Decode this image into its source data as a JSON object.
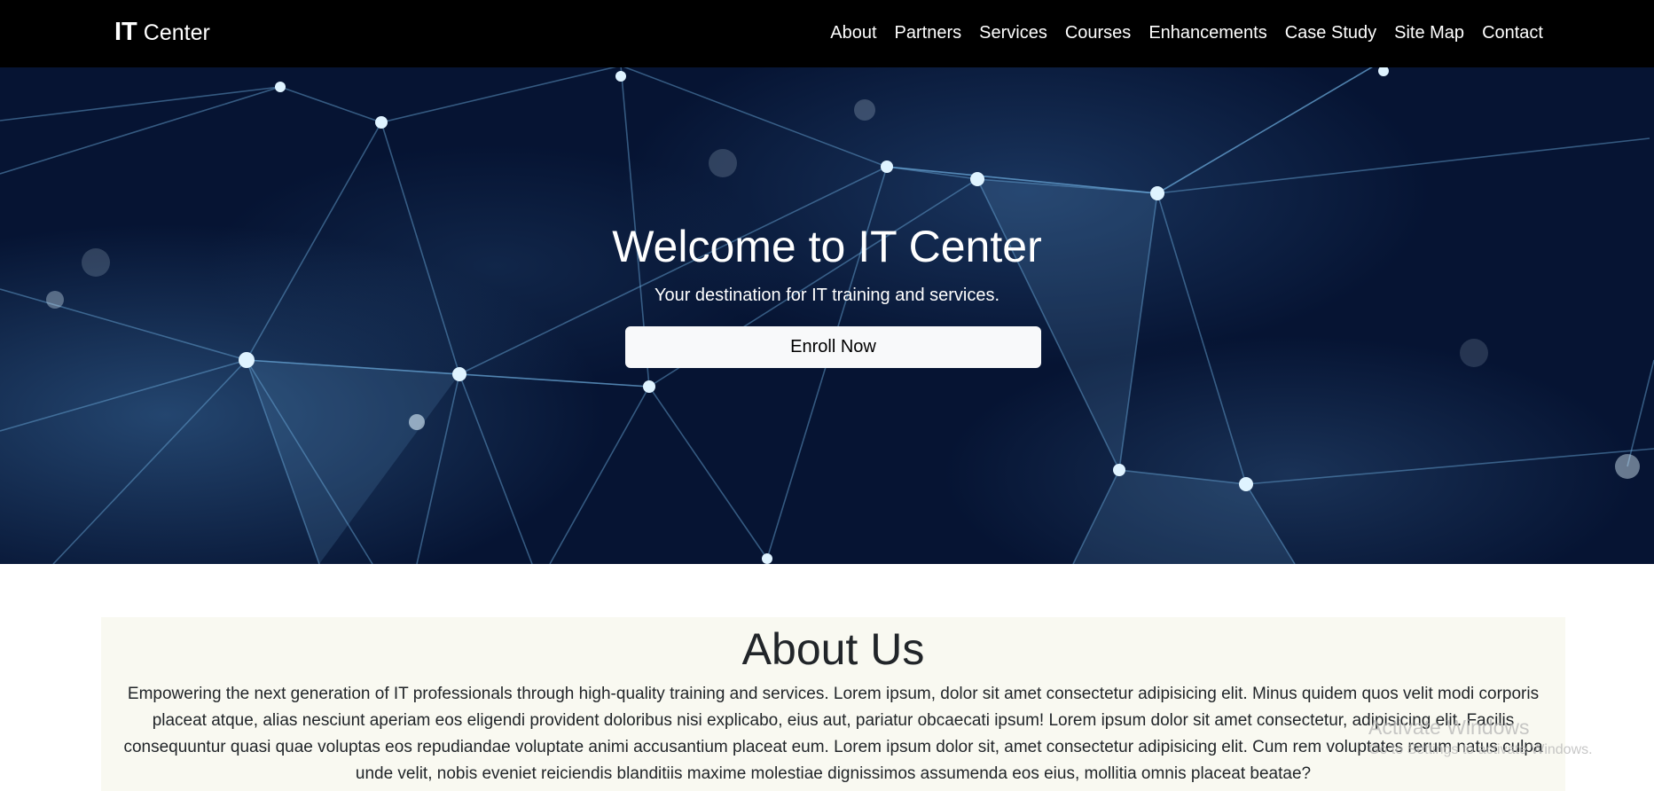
{
  "navbar": {
    "brand_strong": "IT",
    "brand_light": "Center",
    "links": [
      "About",
      "Partners",
      "Services",
      "Courses",
      "Enhancements",
      "Case Study",
      "Site Map",
      "Contact"
    ]
  },
  "hero": {
    "title": "Welcome to IT Center",
    "subtitle": "Your destination for IT training and services.",
    "button_label": "Enroll Now"
  },
  "about": {
    "title": "About Us",
    "text": "Empowering the next generation of IT professionals through high-quality training and services. Lorem ipsum, dolor sit amet consectetur adipisicing elit. Minus quidem quos velit modi corporis placeat atque, alias nesciunt aperiam eos eligendi provident doloribus nisi explicabo, eius aut, pariatur obcaecati ipsum! Lorem ipsum dolor sit amet consectetur, adipisicing elit. Facilis consequuntur quasi quae voluptas eos repudiandae voluptate animi accusantium placeat eum. Lorem ipsum dolor sit, amet consectetur adipisicing elit. Cum rem voluptates rerum natus culpa unde velit, nobis eveniet reiciendis blanditiis maxime molestiae dignissimos assumenda eos eius, mollitia omnis placeat beatae?"
  },
  "watermark": {
    "title": "Activate Windows",
    "subtitle": "Go to Settings to activate Windows."
  },
  "colors": {
    "navbar_bg": "#000000",
    "hero_bg": "#061433",
    "network_line": "#6fb0e0",
    "button_bg": "#f8f9fa",
    "about_bg": "#f9f9f1"
  }
}
